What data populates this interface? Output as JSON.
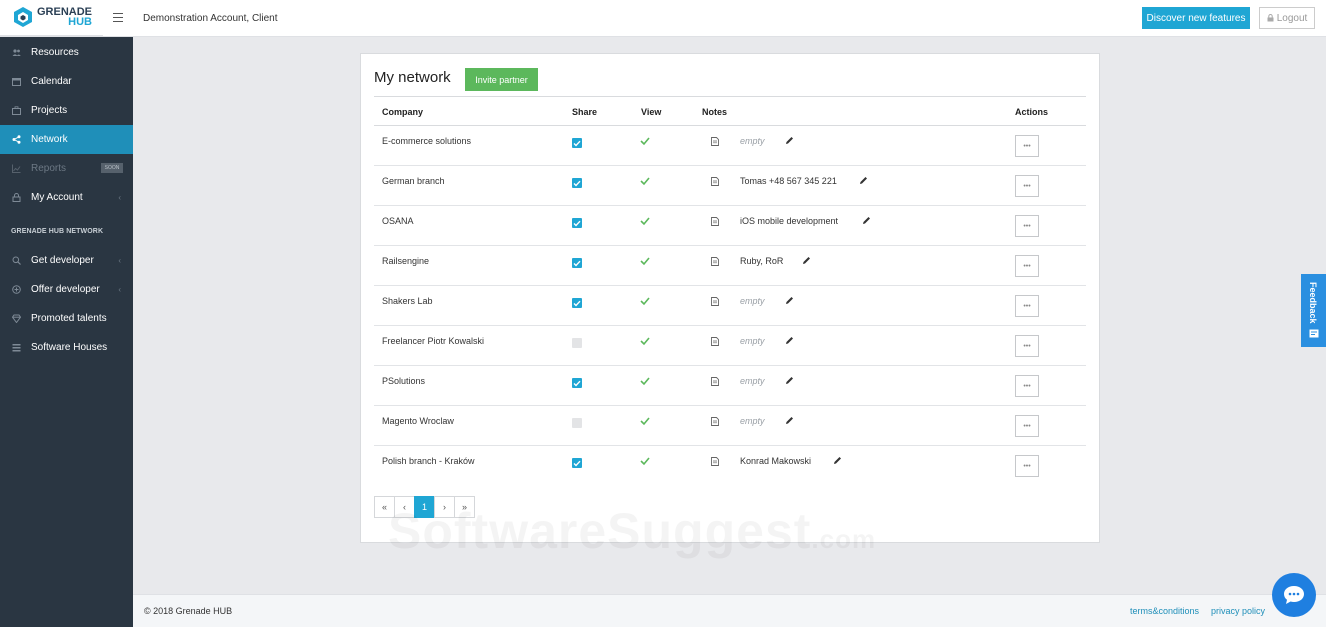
{
  "brand": {
    "name_top": "GRENADE",
    "name_bottom": "HUB"
  },
  "header": {
    "account": "Demonstration Account, Client",
    "discover_label": "Discover new features",
    "logout_label": "Logout"
  },
  "sidebar": {
    "items": [
      {
        "label": "Resources",
        "icon": "users-icon"
      },
      {
        "label": "Calendar",
        "icon": "calendar-icon"
      },
      {
        "label": "Projects",
        "icon": "briefcase-icon"
      },
      {
        "label": "Network",
        "icon": "share-icon",
        "active": true
      },
      {
        "label": "Reports",
        "icon": "chart-icon",
        "disabled": true,
        "badge": "SOON"
      },
      {
        "label": "My Account",
        "icon": "lock-icon",
        "has_submenu": true
      }
    ],
    "section_title": "GRENADE HUB NETWORK",
    "network_items": [
      {
        "label": "Get developer",
        "icon": "search-icon",
        "has_submenu": true
      },
      {
        "label": "Offer developer",
        "icon": "plus-circle-icon",
        "has_submenu": true
      },
      {
        "label": "Promoted talents",
        "icon": "diamond-icon"
      },
      {
        "label": "Software Houses",
        "icon": "list-icon"
      }
    ]
  },
  "main": {
    "title": "My network",
    "invite_label": "Invite partner",
    "columns": {
      "company": "Company",
      "share": "Share",
      "view": "View",
      "notes": "Notes",
      "actions": "Actions"
    },
    "rows": [
      {
        "company": "E-commerce solutions",
        "share": true,
        "view": true,
        "note": "empty",
        "note_empty": true
      },
      {
        "company": "German branch",
        "share": true,
        "view": true,
        "note": "Tomas +48 567 345 221",
        "note_empty": false
      },
      {
        "company": "OSANA",
        "share": true,
        "view": true,
        "note": "iOS mobile development",
        "note_empty": false
      },
      {
        "company": "Railsengine",
        "share": true,
        "view": true,
        "note": "Ruby, RoR",
        "note_empty": false
      },
      {
        "company": "Shakers Lab",
        "share": true,
        "view": true,
        "note": "empty",
        "note_empty": true
      },
      {
        "company": "Freelancer Piotr Kowalski",
        "share": false,
        "view": true,
        "note": "empty",
        "note_empty": true
      },
      {
        "company": "PSolutions",
        "share": true,
        "view": true,
        "note": "empty",
        "note_empty": true
      },
      {
        "company": "Magento Wroclaw",
        "share": false,
        "view": true,
        "note": "empty",
        "note_empty": true
      },
      {
        "company": "Polish branch - Kraków",
        "share": true,
        "view": true,
        "note": "Konrad Makowski",
        "note_empty": false
      }
    ],
    "action_label": "•••",
    "pagination": {
      "first": "«",
      "prev": "‹",
      "current": "1",
      "next": "›",
      "last": "»"
    }
  },
  "watermark": {
    "main": "SoftwareSuggest",
    "suffix": ".com"
  },
  "footer": {
    "copyright": "© 2018 Grenade HUB",
    "terms": "terms&conditions",
    "privacy": "privacy policy"
  },
  "feedback_label": "Feedback",
  "colors": {
    "accent": "#1fa6d4",
    "sidebar": "#2a3642",
    "active": "#1f8fb9",
    "success": "#5cb85c"
  }
}
